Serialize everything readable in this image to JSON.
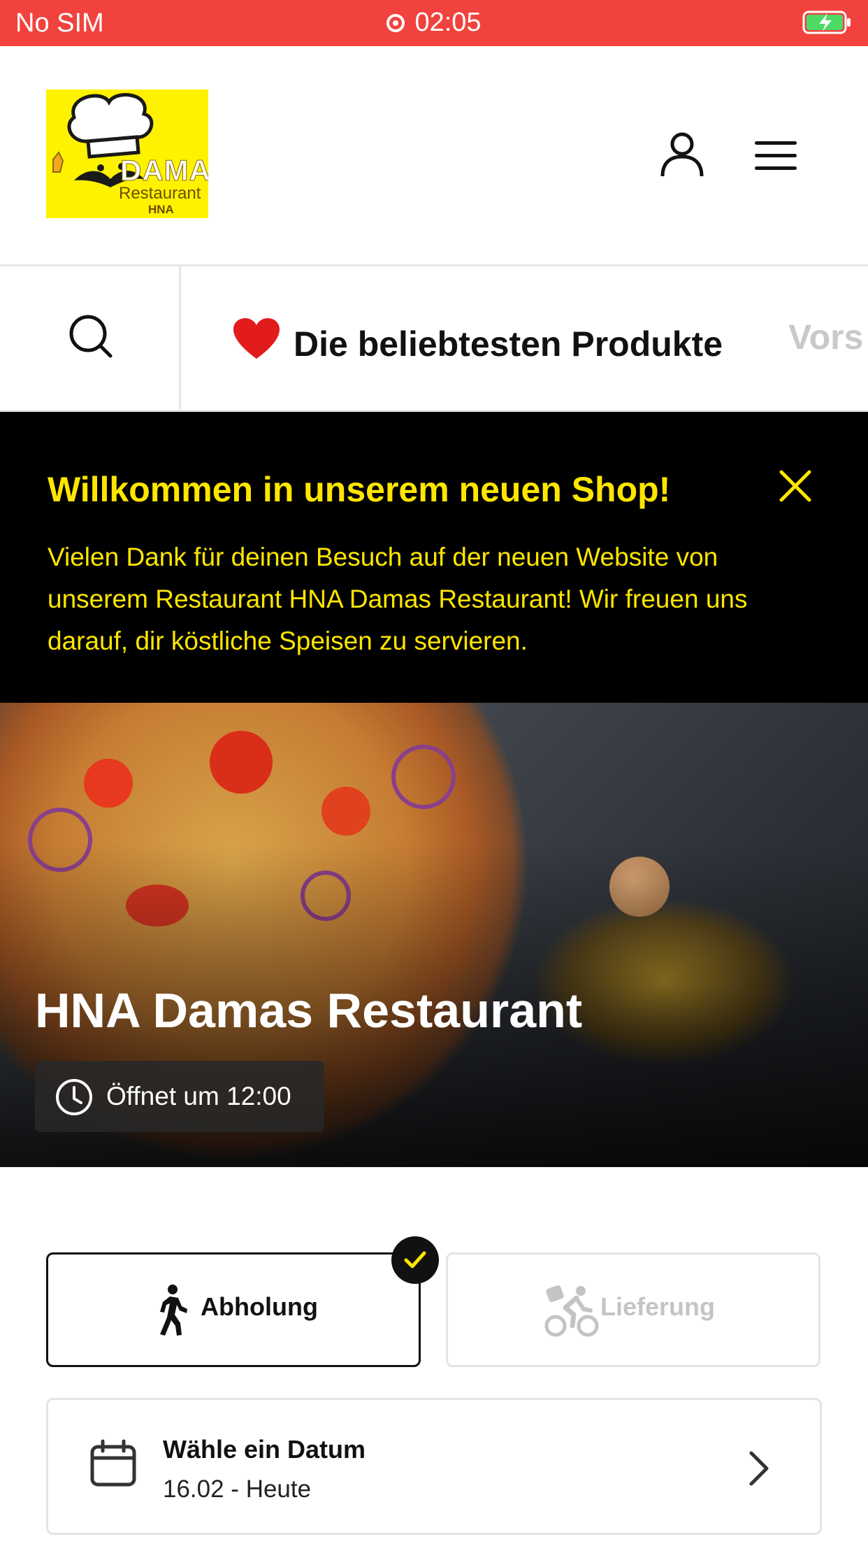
{
  "status_bar": {
    "carrier": "No SIM",
    "time": "02:05",
    "background": "#f2423d",
    "battery_icon": "battery-charging-icon"
  },
  "header": {
    "logo": {
      "line1": "DAMAS",
      "line2": "Restaurant",
      "line3": "HNA"
    },
    "icons": [
      "user-icon",
      "menu-icon"
    ]
  },
  "nav": {
    "items": [
      {
        "label": "Die beliebtesten Produkte",
        "icon": "heart-icon",
        "active": true
      },
      {
        "label": "Vors",
        "active": false
      }
    ]
  },
  "banner": {
    "title": "Willkommen in unserem neuen Shop!",
    "text": "Vielen Dank für deinen Besuch auf der neuen Website von unserem Restaurant HNA Damas Restaurant! Wir freuen uns darauf, dir köstliche Speisen zu servieren.",
    "accent": "#ffe600"
  },
  "hero": {
    "title": "HNA Damas Restaurant",
    "hours": "Öffnet um 12:00"
  },
  "order_type": {
    "pickup": {
      "label": "Abholung",
      "selected": true
    },
    "delivery": {
      "label": "Lieferung",
      "selected": false
    }
  },
  "date": {
    "label": "Wähle ein Datum",
    "value": "16.02 - Heute"
  }
}
